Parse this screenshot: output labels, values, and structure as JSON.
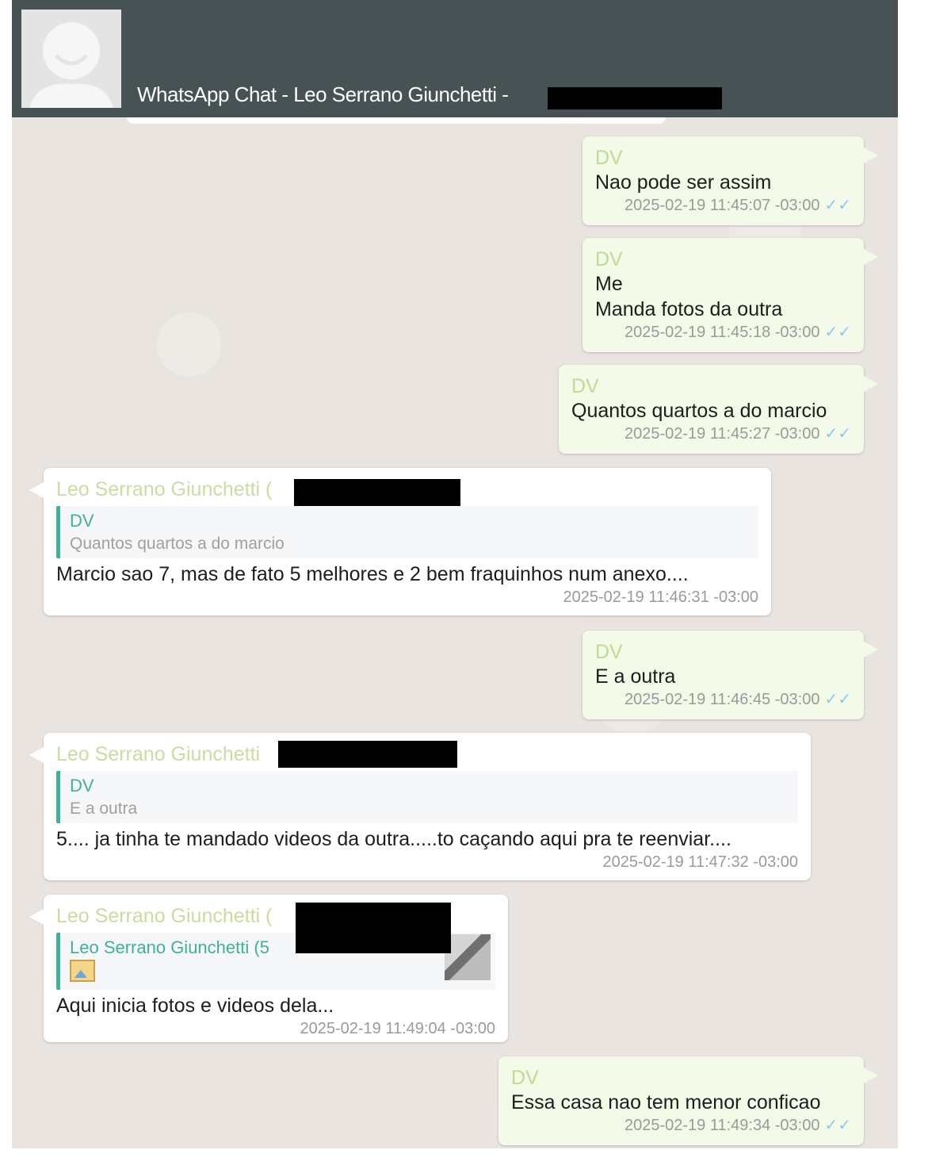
{
  "header": {
    "title": "WhatsApp Chat - Leo Serrano Giunchetti -"
  },
  "messages": [
    {
      "type": "out",
      "sender": "DV",
      "lines": [
        "Nao pode ser assim"
      ],
      "time": "2025-02-19 11:45:07 -03:00"
    },
    {
      "type": "out",
      "sender": "DV",
      "lines": [
        "Me",
        "Manda fotos da outra"
      ],
      "time": "2025-02-19 11:45:18 -03:00"
    },
    {
      "type": "out",
      "sender": "DV",
      "lines": [
        "Quantos quartos a do marcio"
      ],
      "time": "2025-02-19 11:45:27 -03:00"
    },
    {
      "type": "in",
      "sender": "Leo Serrano Giunchetti (",
      "quote": {
        "name": "DV",
        "text": "Quantos quartos a do marcio"
      },
      "text": "Marcio sao 7, mas de fato 5 melhores e 2 bem fraquinhos num anexo....",
      "time": "2025-02-19 11:46:31 -03:00"
    },
    {
      "type": "out",
      "sender": "DV",
      "lines": [
        "E a outra"
      ],
      "time": "2025-02-19 11:46:45 -03:00"
    },
    {
      "type": "in",
      "sender": "Leo Serrano Giunchetti",
      "quote": {
        "name": "DV",
        "text": "E a outra"
      },
      "text": "5.... ja tinha te mandado videos da outra.....to caçando aqui pra te reenviar....",
      "time": "2025-02-19 11:47:32 -03:00"
    },
    {
      "type": "in",
      "sender": "Leo Serrano Giunchetti (",
      "sender_suffix": ")",
      "quote": {
        "name": "Leo Serrano Giunchetti (5"
      },
      "text": "Aqui inicia fotos e videos dela...",
      "time": "2025-02-19 11:49:04 -03:00"
    },
    {
      "type": "out",
      "sender": "DV",
      "lines": [
        "Essa casa nao tem menor conficao"
      ],
      "time": "2025-02-19 11:49:34 -03:00"
    }
  ],
  "ticks": "✓✓"
}
